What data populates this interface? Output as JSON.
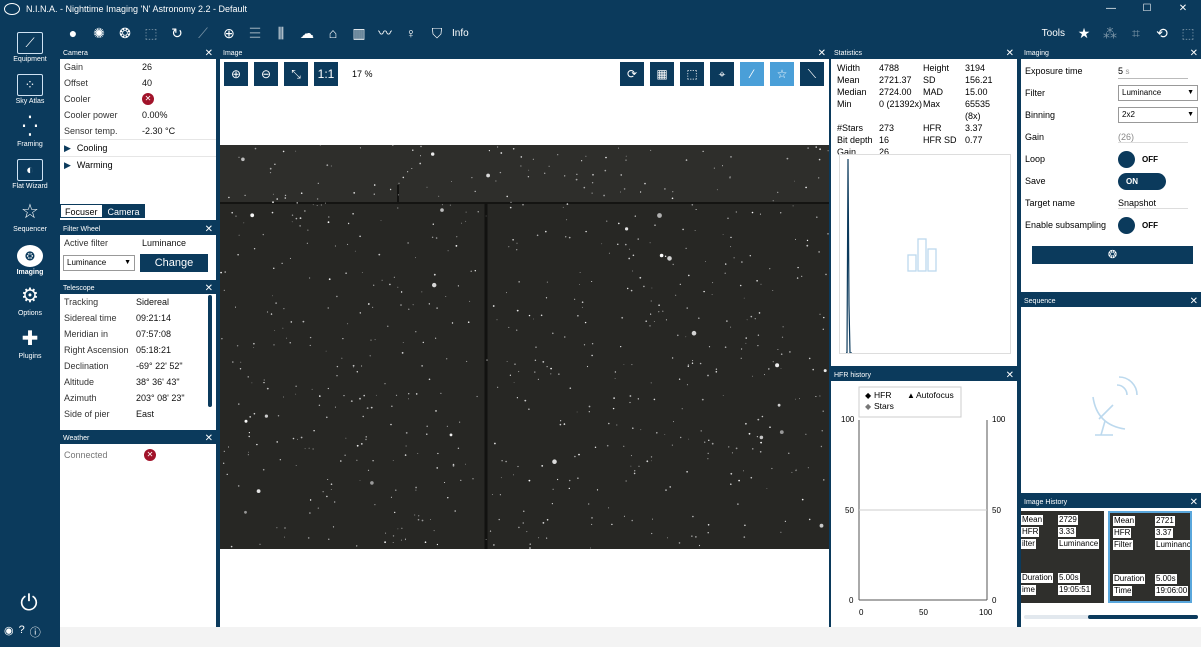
{
  "window": {
    "title": "N.I.N.A. - Nighttime Imaging 'N' Astronomy 2.2  -  Default",
    "controls": [
      "—",
      "☐",
      "✕"
    ]
  },
  "toolbar": {
    "info_label": "Info",
    "tools_label": "Tools"
  },
  "sidebar": {
    "items": [
      {
        "label": "Equipment",
        "icon": "telescope-icon"
      },
      {
        "label": "Sky Atlas",
        "icon": "map-icon"
      },
      {
        "label": "Framing",
        "icon": "framing-icon"
      },
      {
        "label": "Flat Wizard",
        "icon": "wand-icon"
      },
      {
        "label": "Sequencer",
        "icon": "list-icon"
      },
      {
        "label": "Imaging",
        "icon": "aperture-icon"
      },
      {
        "label": "Options",
        "icon": "gears-icon"
      },
      {
        "label": "Plugins",
        "icon": "puzzle-icon"
      }
    ],
    "collapse_label": "<<"
  },
  "camera": {
    "header": "Camera",
    "rows": [
      {
        "k": "Gain",
        "v": "26"
      },
      {
        "k": "Offset",
        "v": "40"
      },
      {
        "k": "Cooler",
        "v": ""
      },
      {
        "k": "Cooler power",
        "v": "0.00%"
      },
      {
        "k": "Sensor temp.",
        "v": "-2.30 °C"
      }
    ],
    "cooling": "Cooling",
    "warming": "Warming",
    "tabs": [
      "Focuser",
      "Camera"
    ]
  },
  "filter_wheel": {
    "header": "Filter Wheel",
    "active_filter_label": "Active filter",
    "active_filter_value": "Luminance",
    "select_value": "Luminance",
    "change_label": "Change"
  },
  "telescope": {
    "header": "Telescope",
    "rows": [
      {
        "k": "Tracking",
        "v": "Sidereal"
      },
      {
        "k": "Sidereal time",
        "v": "09:21:14"
      },
      {
        "k": "Meridian in",
        "v": "07:57:08"
      },
      {
        "k": "Right Ascension",
        "v": "05:18:21"
      },
      {
        "k": "Declination",
        "v": "-69° 22' 52\""
      },
      {
        "k": "Altitude",
        "v": "38° 36' 43\""
      },
      {
        "k": "Azimuth",
        "v": "203° 08' 23\""
      },
      {
        "k": "Side of pier",
        "v": "East"
      }
    ]
  },
  "weather": {
    "header": "Weather",
    "connected_label": "Connected"
  },
  "image": {
    "header": "Image",
    "zoom_1to1": "1:1",
    "zoom_percent": "17 %"
  },
  "statistics": {
    "header": "Statistics",
    "rows": [
      [
        "Width",
        "4788",
        "Height",
        "3194"
      ],
      [
        "Mean",
        "2721.37",
        "SD",
        "156.21"
      ],
      [
        "Median",
        "2724.00",
        "MAD",
        "15.00"
      ],
      [
        "Min",
        "0 (21392x)",
        "Max",
        "65535 (8x)"
      ],
      [
        "#Stars",
        "273",
        "HFR",
        "3.37"
      ],
      [
        "Bit depth",
        "16",
        "HFR SD",
        "0.77"
      ],
      [
        "Gain",
        "26",
        "",
        ""
      ]
    ]
  },
  "hfr_history": {
    "header": "HFR history",
    "legend": [
      "HFR",
      "Autofocus",
      "Stars"
    ],
    "y_ticks": [
      "100",
      "50",
      "0"
    ],
    "x_ticks": [
      "0",
      "50",
      "100"
    ]
  },
  "imaging": {
    "header": "Imaging",
    "exposure_label": "Exposure time",
    "exposure_value": "5",
    "exposure_unit": "s",
    "filter_label": "Filter",
    "filter_value": "Luminance",
    "binning_label": "Binning",
    "binning_value": "2x2",
    "gain_label": "Gain",
    "gain_value": "(26)",
    "loop_label": "Loop",
    "loop_state": "OFF",
    "save_label": "Save",
    "save_state": "ON",
    "target_label": "Target name",
    "target_value": "Snapshot",
    "subsampling_label": "Enable subsampling",
    "subsampling_state": "OFF"
  },
  "sequence": {
    "header": "Sequence"
  },
  "image_history": {
    "header": "Image History",
    "items": [
      {
        "mean_l": "Mean",
        "mean": "2729",
        "hfr_l": "HFR",
        "hfr": "3.33",
        "filter_l": "ilter",
        "filter": "Luminance",
        "dur_l": "Duration",
        "dur": "5.00s",
        "time_l": "ime",
        "time": "19:05:51"
      },
      {
        "mean_l": "Mean",
        "mean": "2721",
        "hfr_l": "HFR",
        "hfr": "3.37",
        "filter_l": "Filter",
        "filter": "Luminance",
        "dur_l": "Duration",
        "dur": "5.00s",
        "time_l": "Time",
        "time": "19:06:00"
      }
    ]
  }
}
